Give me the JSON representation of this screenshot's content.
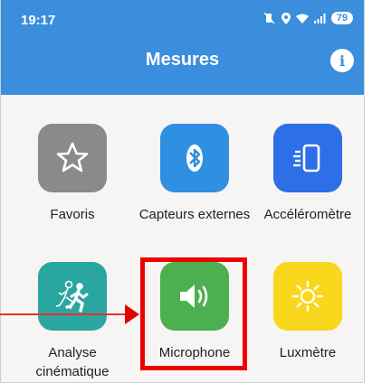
{
  "status_bar": {
    "time": "19:17",
    "battery": "79"
  },
  "header": {
    "title": "Mesures",
    "info": "i"
  },
  "tiles": [
    {
      "label": "Favoris",
      "color": "#8a8a8a",
      "icon": "star-icon"
    },
    {
      "label": "Capteurs externes",
      "color": "#2f8fe0",
      "icon": "bluetooth-icon"
    },
    {
      "label": "Accéléromètre",
      "color": "#2d6fe6",
      "icon": "phone-vibrate-icon"
    },
    {
      "label": "Analyse cinématique",
      "color": "#2aa6a0",
      "icon": "runners-icon"
    },
    {
      "label": "Microphone",
      "color": "#4caf50",
      "icon": "speaker-icon"
    },
    {
      "label": "Luxmètre",
      "color": "#f8d71c",
      "icon": "sun-icon"
    }
  ]
}
